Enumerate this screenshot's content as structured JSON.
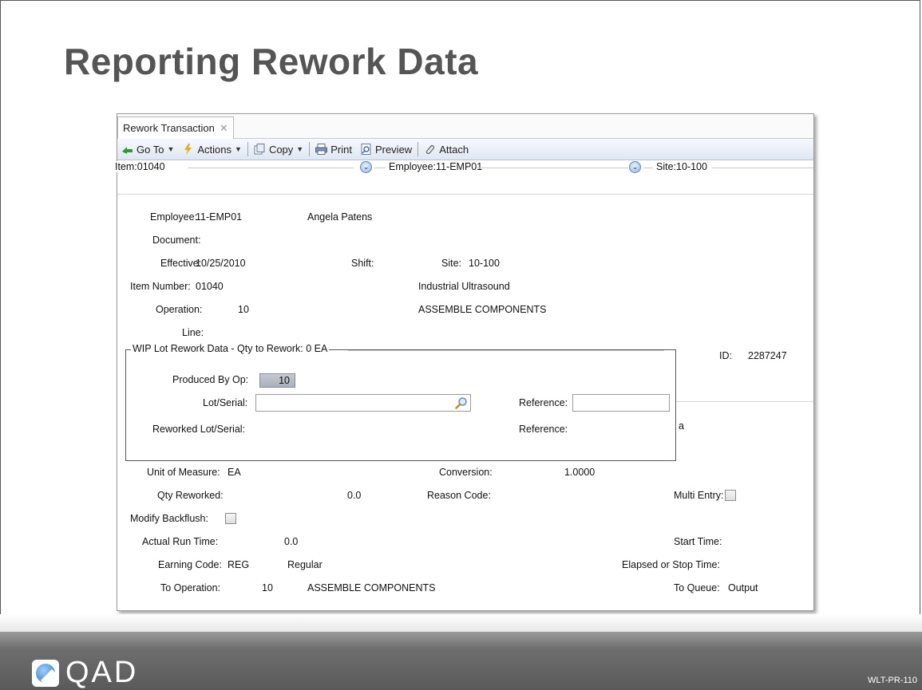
{
  "slide": {
    "title": "Reporting Rework Data",
    "logo_text": "QAD",
    "code": "WLT-PR-110"
  },
  "tab": {
    "label": "Rework Transaction",
    "close": "✕"
  },
  "toolbar": {
    "goto": "Go To",
    "actions": "Actions",
    "copy": "Copy",
    "print": "Print",
    "preview": "Preview",
    "attach": "Attach"
  },
  "frames": {
    "item": "Item:01040",
    "employee": "Employee:11-EMP01",
    "site": "Site:10-100"
  },
  "form": {
    "employee_label": "Employee:",
    "employee_value": "11-EMP01",
    "employee_name": "Angela Patens",
    "document_label": "Document:",
    "effective_label": "Effective:",
    "effective_value": "10/25/2010",
    "shift_label": "Shift:",
    "site_label": "Site:",
    "site_value": "10-100",
    "item_label": "Item Number:",
    "item_value": "01040",
    "item_desc": "Industrial Ultrasound",
    "operation_label": "Operation:",
    "operation_value": "10",
    "operation_desc": "ASSEMBLE COMPONENTS",
    "line_label": "Line:",
    "id_label": "ID:",
    "id_value": "2287247",
    "uom_label": "Unit of Measure:",
    "uom_value": "EA",
    "conversion_label": "Conversion:",
    "conversion_value": "1.0000",
    "qty_label": "Qty Reworked:",
    "qty_value": "0.0",
    "reason_label": "Reason Code:",
    "multi_label": "Multi Entry:",
    "backflush_label": "Modify Backflush:",
    "runtime_label": "Actual Run Time:",
    "runtime_value": "0.0",
    "start_label": "Start Time:",
    "earning_label": "Earning Code:",
    "earning_value": "REG",
    "earning_desc": "Regular",
    "elapsed_label": "Elapsed or Stop Time:",
    "toop_label": "To Operation:",
    "toop_value": "10",
    "toop_desc": "ASSEMBLE COMPONENTS",
    "toqueue_label": "To Queue:",
    "toqueue_value": "Output",
    "behind_text": "a"
  },
  "wip": {
    "title": "WIP Lot Rework Data - Qty to Rework: 0 EA",
    "produced_label": "Produced By Op:",
    "produced_value": "10",
    "lot_label": "Lot/Serial:",
    "lot_value": "",
    "reference_label": "Reference:",
    "reference_value": "",
    "reworked_label": "Reworked Lot/Serial:",
    "reference2_label": "Reference:"
  }
}
